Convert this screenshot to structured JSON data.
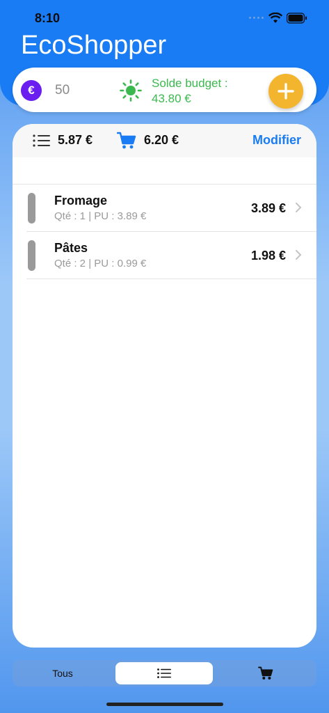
{
  "status": {
    "time": "8:10"
  },
  "app": {
    "title": "EcoShopper"
  },
  "budget": {
    "value": "50",
    "balance_label": "Solde budget :",
    "balance_value": "43.80 €"
  },
  "toolbar": {
    "list_total": "5.87 €",
    "cart_total": "6.20 €",
    "edit_label": "Modifier"
  },
  "items": [
    {
      "name": "Fromage",
      "detail": "Qté : 1  |  PU : 3.89 €",
      "price": "3.89 €"
    },
    {
      "name": "Pâtes",
      "detail": "Qté : 2  |  PU : 0.99 €",
      "price": "1.98 €"
    }
  ],
  "tabs": {
    "all_label": "Tous"
  },
  "colors": {
    "accent": "#1a7cf5",
    "budget_icon": "#6a1ff0",
    "balance_green": "#3bb94f",
    "add_button": "#f3b42e"
  }
}
